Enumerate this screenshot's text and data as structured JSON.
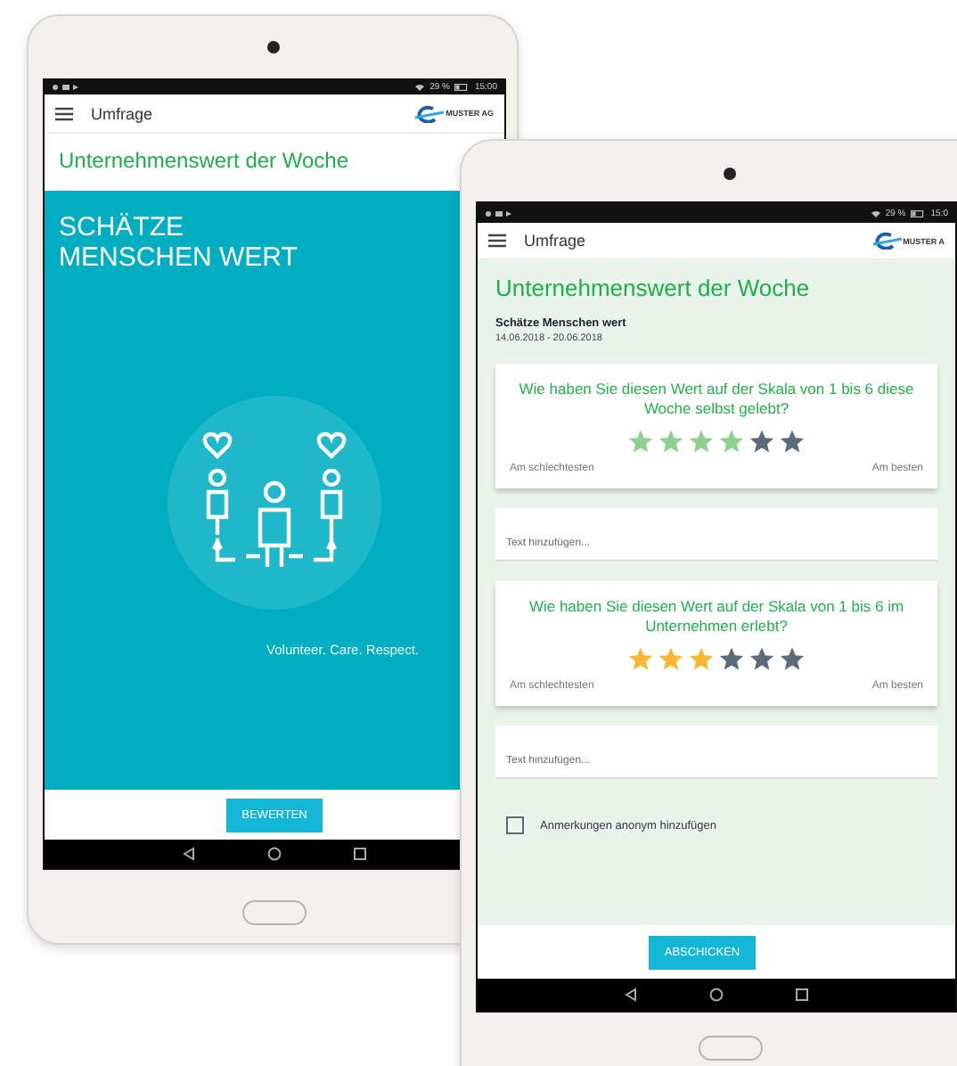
{
  "tablet_intro": {
    "status": {
      "battery": "29 %",
      "time": "15:00"
    },
    "app_bar": {
      "title": "Umfrage",
      "logo": "MUSTER AG"
    },
    "heading": "Unternehmenswert der Woche",
    "banner": {
      "title": "SCHÄTZE\nMENSCHEN WERT",
      "tagline": "Volunteer. Care. Respect."
    },
    "button": "BEWERTEN"
  },
  "tablet_survey": {
    "status": {
      "battery": "29 %",
      "time": "15:0"
    },
    "app_bar": {
      "title": "Umfrage",
      "logo": "MUSTER A"
    },
    "heading": "Unternehmenswert der Woche",
    "subtitle": "Schätze Menschen wert",
    "dates": "14.06.2018 - 20.06.2018",
    "sections": [
      {
        "question": "Wie haben Sie diesen Wert auf der Skala von 1 bis 6 diese Woche selbst gelebt?",
        "stars": 4,
        "color": "#8fcf8f",
        "low": "Am schlechtesten",
        "high": "Am besten",
        "comment": {
          "placeholder": "Text hinzufügen..."
        }
      },
      {
        "question": "Wie haben Sie diesen Wert auf der Skala von 1 bis 6 im Unternehmen erlebt?",
        "stars": 3,
        "color": "#f7b733",
        "low": "Am schlechtesten",
        "high": "Am besten",
        "comment": {
          "placeholder": "Text hinzufügen..."
        }
      }
    ],
    "anonymous": {
      "label": "Anmerkungen anonym hinzufügen",
      "checked": false
    },
    "button": "ABSCHICKEN"
  }
}
